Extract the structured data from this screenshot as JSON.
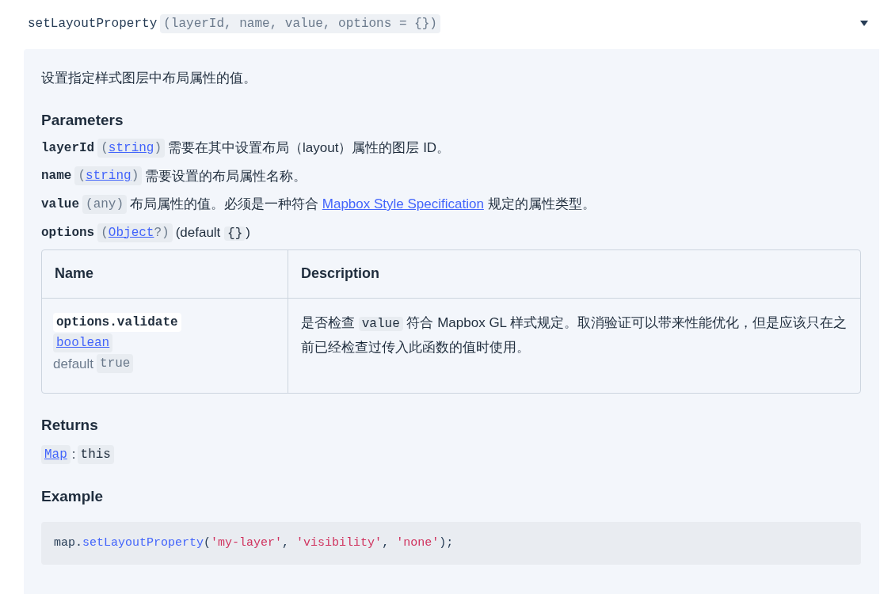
{
  "header": {
    "name": "setLayoutProperty",
    "signature": "(layerId, name, value, options = {})",
    "expanded": true
  },
  "description": "设置指定样式图层中布局属性的值。",
  "parameters": {
    "heading": "Parameters",
    "items": [
      {
        "name": "layerId",
        "type": {
          "open": "(",
          "name": "string",
          "linked": true,
          "close": ")"
        },
        "segments": [
          {
            "kind": "text",
            "text": "需要在其中设置布局（layout）属性的图层 ID。"
          }
        ]
      },
      {
        "name": "name",
        "type": {
          "open": "(",
          "name": "string",
          "linked": true,
          "close": ")"
        },
        "segments": [
          {
            "kind": "text",
            "text": "需要设置的布局属性名称。"
          }
        ]
      },
      {
        "name": "value",
        "type": {
          "open": "(",
          "name": "any",
          "linked": false,
          "close": ")"
        },
        "segments": [
          {
            "kind": "text",
            "text": "布局属性的值。必须是一种符合 "
          },
          {
            "kind": "link",
            "text": "Mapbox Style Specification"
          },
          {
            "kind": "text",
            "text": " 规定的属性类型。"
          }
        ]
      },
      {
        "name": "options",
        "type": {
          "open": "(",
          "name": "Object",
          "linked": true,
          "close": "?)"
        },
        "segments": [
          {
            "kind": "text",
            "text": "(default "
          },
          {
            "kind": "code",
            "text": "{}"
          },
          {
            "kind": "text",
            "text": ")"
          }
        ]
      }
    ]
  },
  "table": {
    "columns": [
      "Name",
      "Description"
    ],
    "rows": [
      {
        "name": "options.validate",
        "type": "boolean",
        "default_label": "default",
        "default_value": "true",
        "segments": [
          {
            "kind": "text",
            "text": "是否检查 "
          },
          {
            "kind": "code",
            "text": "value"
          },
          {
            "kind": "text",
            "text": " 符合 Mapbox GL 样式规定。取消验证可以带来性能优化，但是应该只在之前已经检查过传入此函数的值时使用。"
          }
        ]
      }
    ]
  },
  "returns": {
    "heading": "Returns",
    "type": "Map",
    "separator": ":",
    "value": "this"
  },
  "example": {
    "heading": "Example",
    "tokens": [
      {
        "kind": "plain",
        "text": "map."
      },
      {
        "kind": "method",
        "text": "setLayoutProperty"
      },
      {
        "kind": "plain",
        "text": "("
      },
      {
        "kind": "string",
        "text": "'my-layer'"
      },
      {
        "kind": "plain",
        "text": ", "
      },
      {
        "kind": "string",
        "text": "'visibility'"
      },
      {
        "kind": "plain",
        "text": ", "
      },
      {
        "kind": "string",
        "text": "'none'"
      },
      {
        "kind": "plain",
        "text": ");"
      }
    ]
  }
}
